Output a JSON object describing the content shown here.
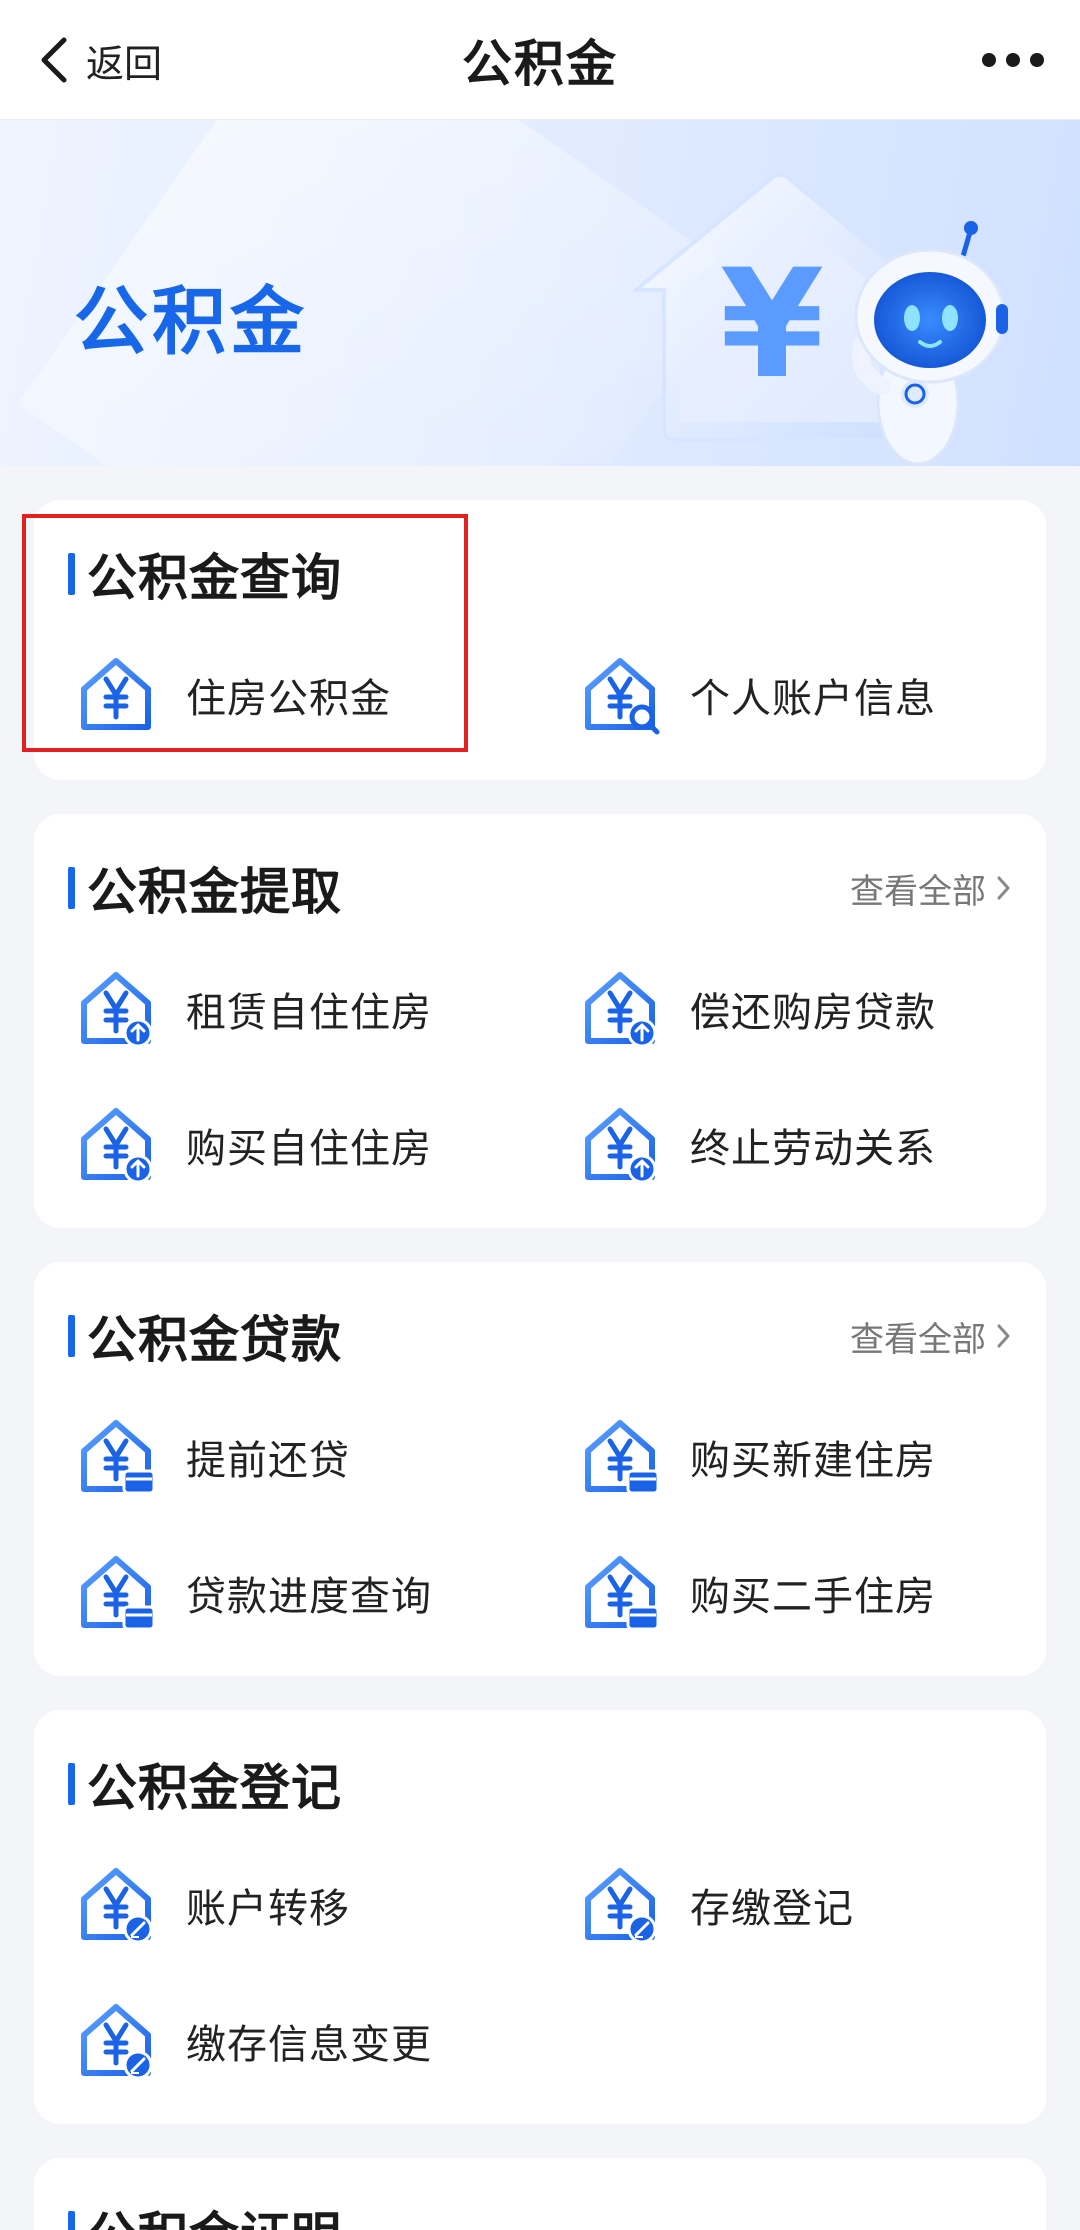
{
  "nav": {
    "back_label": "返回",
    "title": "公积金"
  },
  "banner": {
    "title": "公积金",
    "yuan_symbol": "¥"
  },
  "sections": {
    "query": {
      "title": "公积金查询",
      "items": [
        "住房公积金",
        "个人账户信息"
      ]
    },
    "withdraw": {
      "title": "公积金提取",
      "view_all": "查看全部",
      "items": [
        "租赁自住住房",
        "偿还购房贷款",
        "购买自住住房",
        "终止劳动关系"
      ]
    },
    "loan": {
      "title": "公积金贷款",
      "view_all": "查看全部",
      "items": [
        "提前还贷",
        "购买新建住房",
        "贷款进度查询",
        "购买二手住房"
      ]
    },
    "register": {
      "title": "公积金登记",
      "items": [
        "账户转移",
        "存缴登记",
        "缴存信息变更"
      ]
    },
    "certificate": {
      "title": "公积金证明"
    }
  },
  "colors": {
    "accent": "#1767e8",
    "highlight": "#e22020",
    "page_bg": "#f4f5f8"
  }
}
